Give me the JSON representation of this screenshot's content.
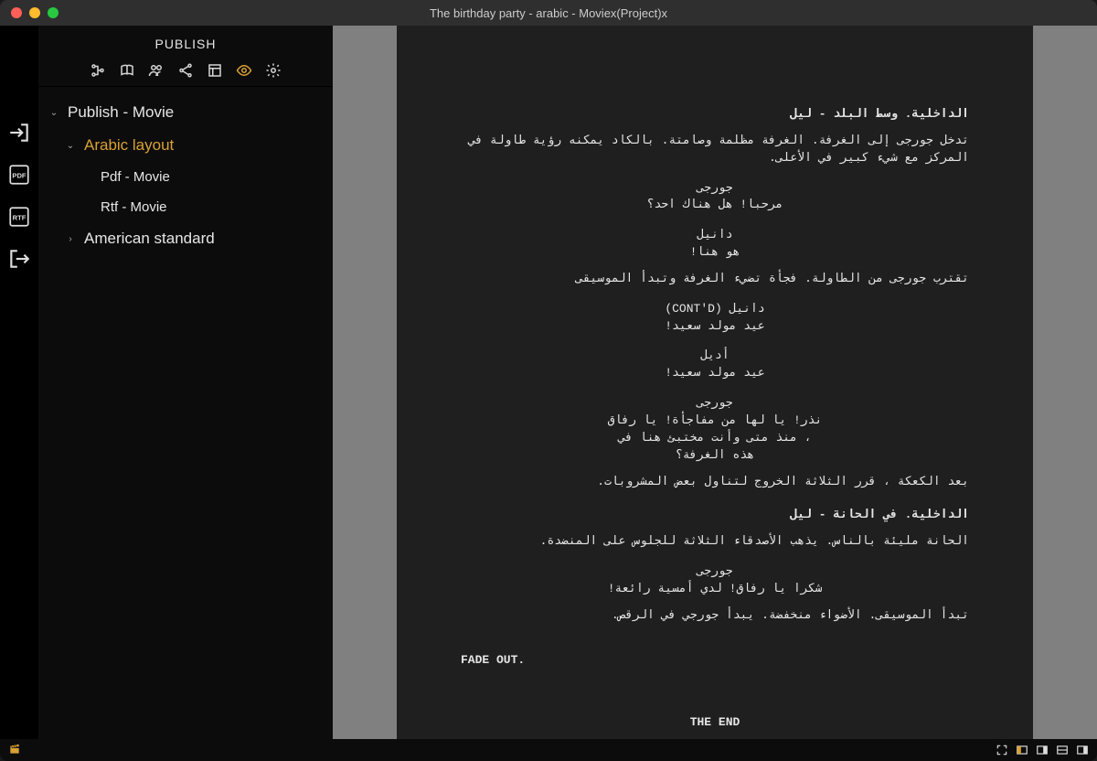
{
  "window": {
    "title": "The birthday party - arabic - Moviex(Project)x"
  },
  "sidebar": {
    "title": "PUBLISH",
    "tree": {
      "root": {
        "label": "Publish - Movie"
      },
      "arabic": {
        "label": "Arabic layout"
      },
      "pdf": {
        "label": "Pdf - Movie"
      },
      "rtf": {
        "label": "Rtf - Movie"
      },
      "american": {
        "label": "American standard"
      }
    }
  },
  "document": {
    "scene1": "الداخلية. وسط البلد - ليل",
    "action1": "تدخل جورجى إلى الغرفة. الغرفة مظلمة وصامتة. بالكاد يمكنه رؤية طاولة في المركز مع شيء كبير في الأعلى.",
    "char1": "جورجى",
    "dialog1": "مرحبا! هل هناك احد؟",
    "char2": "دانيل",
    "dialog2": "هو هنا!",
    "action2": "تقترب جورجى من الطاولة. فجأة تضيء الغرفة وتبدأ الموسيقى",
    "char3": "دانيل (CONT'D)",
    "dialog3": "عيد مولد سعيد!",
    "char4": "أديل",
    "dialog4": "عيد مولد سعيد!",
    "char5": "جورجى",
    "dialog5": "نذر! يا لها من مفاجأة! يا رفاق ، منذ متى وأنت مختبئ هنا في هذه الغرفة؟",
    "action3": "بعد الكعكة ، قرر الثلاثة الخروج لتناول بعض المشروبات.",
    "scene2": "الداخلية. في الحانة - ليل",
    "action4": "الحانة مليئة بالناس. يذهب الأصدقاء الثلاثة للجلوس على المنضدة.",
    "char6": "جورجى",
    "dialog6": "شكرا يا رفاق! لدي أمسية رائعة!",
    "action5": "تبدأ الموسيقى. الأضواء منخفضة. يبدأ جورجي في الرقص.",
    "fade": "FADE OUT.",
    "end": "THE END"
  }
}
